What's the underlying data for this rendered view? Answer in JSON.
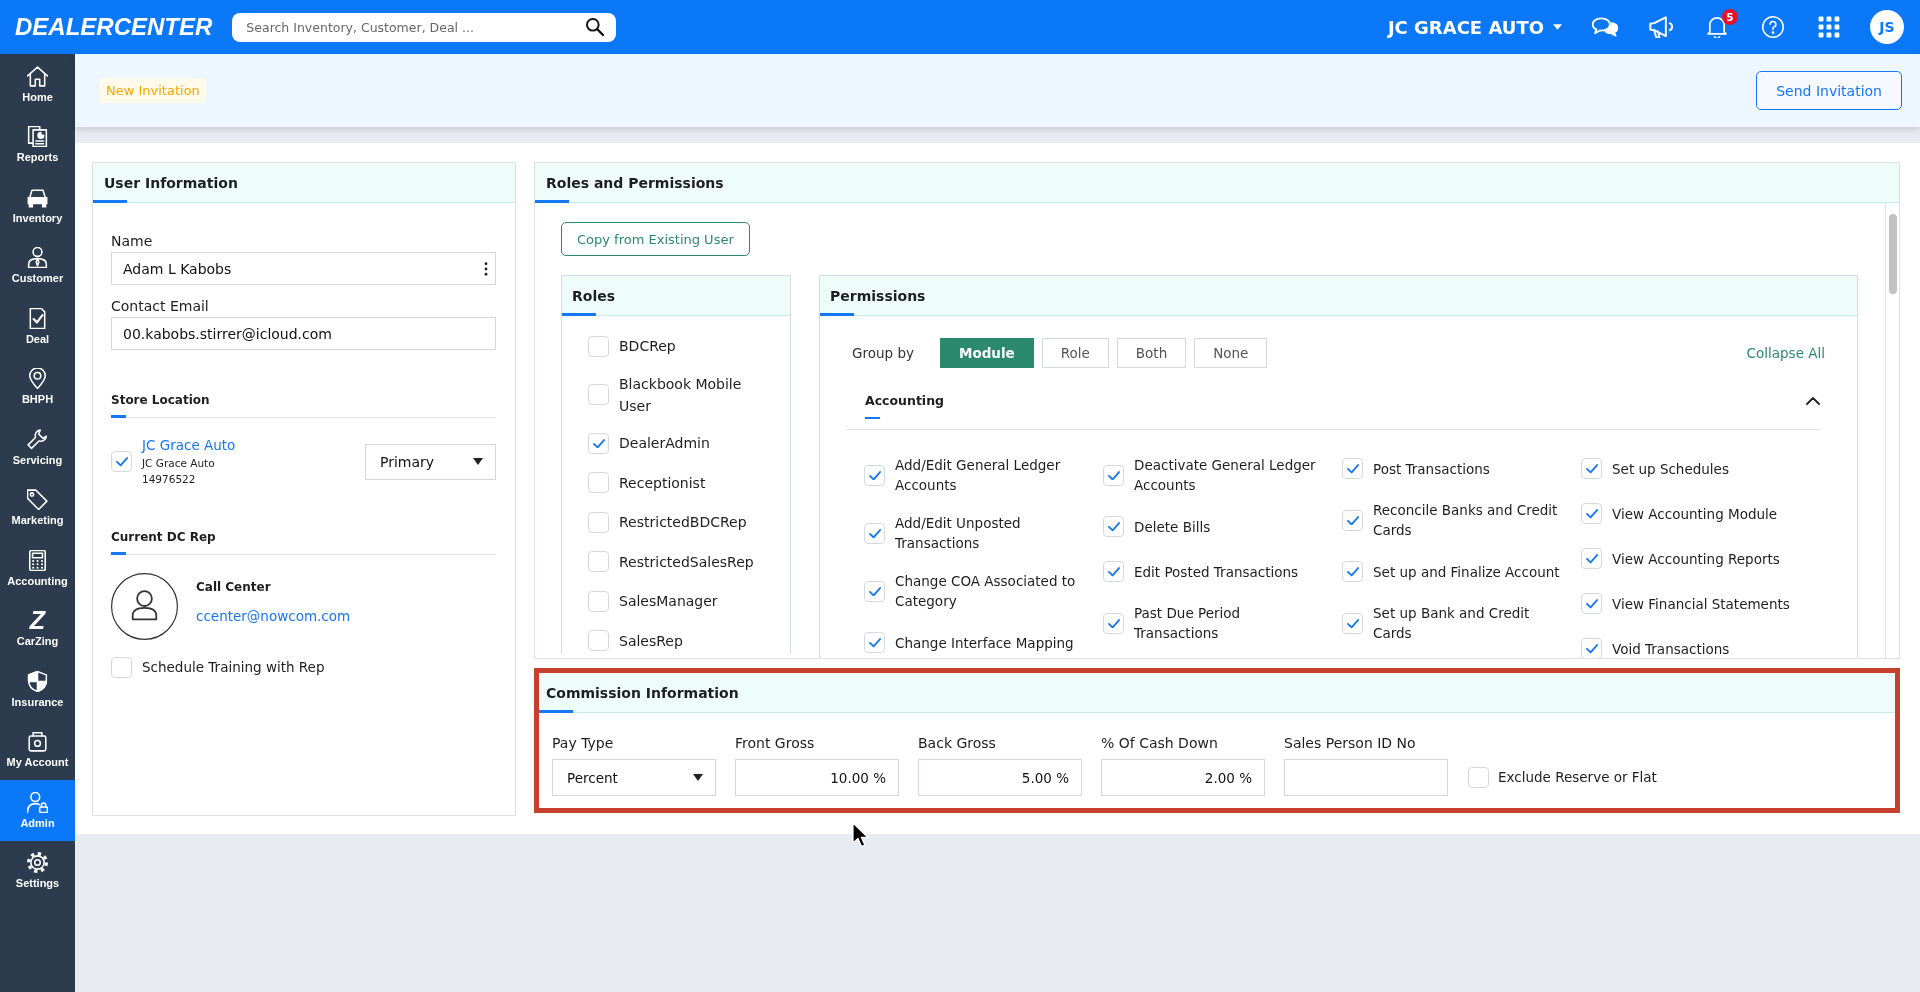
{
  "top_bar": {
    "logo": "DEALERCENTER",
    "search": {
      "placeholder": "Search Inventory, Customer, Deal ..."
    },
    "store_selector": "JC GRACE AUTO",
    "notifications": {
      "badge": "5"
    },
    "avatar": "JS"
  },
  "sidebar": {
    "items": [
      {
        "label": "Home",
        "selected": false
      },
      {
        "label": "Reports",
        "selected": false
      },
      {
        "label": "Inventory",
        "selected": false
      },
      {
        "label": "Customer",
        "selected": false
      },
      {
        "label": "Deal",
        "selected": false
      },
      {
        "label": "BHPH",
        "selected": false
      },
      {
        "label": "Servicing",
        "selected": false
      },
      {
        "label": "Marketing",
        "selected": false
      },
      {
        "label": "Accounting",
        "selected": false
      },
      {
        "label": "CarZing",
        "glyph": "Z",
        "selected": false
      },
      {
        "label": "Insurance",
        "selected": false
      },
      {
        "label": "My Account",
        "selected": false
      },
      {
        "label": "Admin",
        "selected": true
      },
      {
        "label": "Settings",
        "selected": false
      }
    ]
  },
  "page_header": {
    "badge": "New Invitation",
    "send_button": "Send Invitation"
  },
  "user_information": {
    "title": "User Information",
    "name": {
      "label": "Name",
      "value": "Adam L Kabobs"
    },
    "contact_email": {
      "label": "Contact Email",
      "value": "00.kabobs.stirrer@icloud.com"
    },
    "store_location": {
      "title": "Store Location",
      "stores": [
        {
          "name": "JC Grace Auto",
          "subtitle": "JC Grace Auto",
          "number": "14976522",
          "checked": true,
          "role": "Primary"
        }
      ]
    },
    "current_dc_rep": {
      "title": "Current DC Rep",
      "name": "Call Center",
      "email": "ccenter@nowcom.com"
    },
    "schedule_training": {
      "label": "Schedule Training with Rep",
      "checked": false
    }
  },
  "roles_and_permissions": {
    "title": "Roles and Permissions",
    "copy_button": "Copy from Existing User",
    "roles": {
      "title": "Roles",
      "items": [
        {
          "label": "BDCRep",
          "checked": false
        },
        {
          "label": "Blackbook Mobile User",
          "checked": false
        },
        {
          "label": "DealerAdmin",
          "checked": true
        },
        {
          "label": "Receptionist",
          "checked": false
        },
        {
          "label": "RestrictedBDCRep",
          "checked": false
        },
        {
          "label": "RestrictedSalesRep",
          "checked": false
        },
        {
          "label": "SalesManager",
          "checked": false
        },
        {
          "label": "SalesRep",
          "checked": false
        }
      ]
    },
    "permissions": {
      "title": "Permissions",
      "group_by_label": "Group by",
      "group_by_options": [
        {
          "label": "Module",
          "selected": true
        },
        {
          "label": "Role",
          "selected": false
        },
        {
          "label": "Both",
          "selected": false
        },
        {
          "label": "None",
          "selected": false
        }
      ],
      "collapse_all": "Collapse All",
      "modules": [
        {
          "title": "Accounting",
          "expanded": true,
          "columns": [
            {
              "items": [
                {
                  "label": "Add/Edit General Ledger Accounts",
                  "checked": true
                },
                {
                  "label": "Add/Edit Unposted Transactions",
                  "checked": true
                },
                {
                  "label": "Change COA Associated to Category",
                  "checked": true
                },
                {
                  "label": "Change Interface Mapping",
                  "checked": true
                }
              ]
            },
            {
              "items": [
                {
                  "label": "Deactivate General Ledger Accounts",
                  "checked": true
                },
                {
                  "label": "Delete Bills",
                  "checked": true
                },
                {
                  "label": "Edit Posted Transactions",
                  "checked": true
                },
                {
                  "label": "Past Due Period Transactions",
                  "checked": true
                }
              ]
            },
            {
              "items": [
                {
                  "label": "Post Transactions",
                  "checked": true
                },
                {
                  "label": "Reconcile Banks and Credit Cards",
                  "checked": true
                },
                {
                  "label": "Set up and Finalize Account",
                  "checked": true
                },
                {
                  "label": "Set up Bank and Credit Cards",
                  "checked": true
                }
              ]
            },
            {
              "items": [
                {
                  "label": "Set up Schedules",
                  "checked": true
                },
                {
                  "label": "View Accounting Module",
                  "checked": true
                },
                {
                  "label": "View Accounting Reports",
                  "checked": true
                },
                {
                  "label": "View Financial Statements",
                  "checked": true
                },
                {
                  "label": "Void Transactions",
                  "checked": true
                }
              ]
            }
          ]
        }
      ]
    }
  },
  "commission_information": {
    "title": "Commission Information",
    "highlighted": true,
    "fields": [
      {
        "kind": "select",
        "label": "Pay Type",
        "value": "Percent"
      },
      {
        "kind": "input",
        "label": "Front Gross",
        "value": "10.00 %"
      },
      {
        "kind": "input",
        "label": "Back Gross",
        "value": "5.00 %"
      },
      {
        "kind": "input",
        "label": "% Of Cash Down",
        "value": "2.00 %"
      },
      {
        "kind": "input",
        "label": "Sales Person ID No"
      }
    ],
    "exclude_reserve": {
      "label": "Exclude Reserve or Flat",
      "checked": false
    }
  }
}
